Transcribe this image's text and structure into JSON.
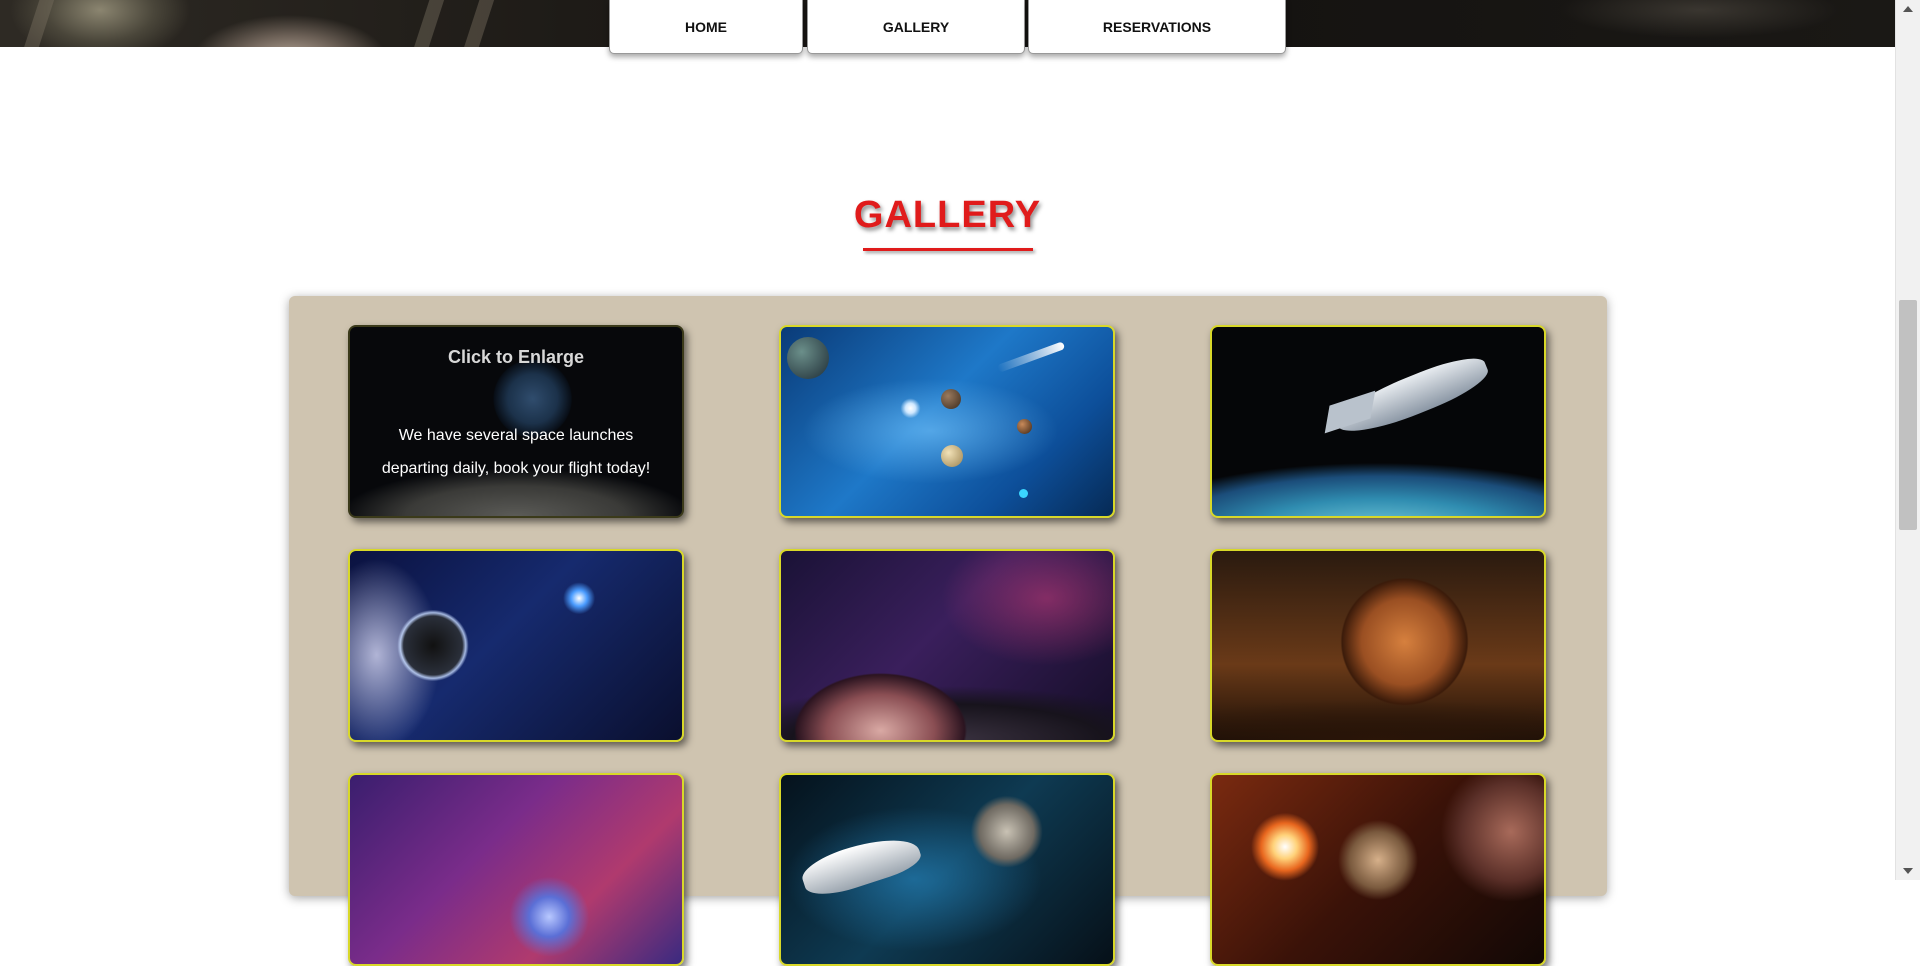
{
  "nav": {
    "home": "HOME",
    "gallery": "GALLERY",
    "reservations": "RESERVATIONS"
  },
  "gallery": {
    "title": "GALLERY",
    "overlay": {
      "heading": "Click to Enlarge",
      "text": "We have several space launches departing daily, book your flight today!"
    }
  },
  "colors": {
    "accent": "#e01b1b",
    "panel": "#cfc4b0",
    "tile_border_highlight": "#d8d829"
  },
  "icons": {
    "scroll_up": "triangle-up",
    "scroll_down": "triangle-down"
  }
}
